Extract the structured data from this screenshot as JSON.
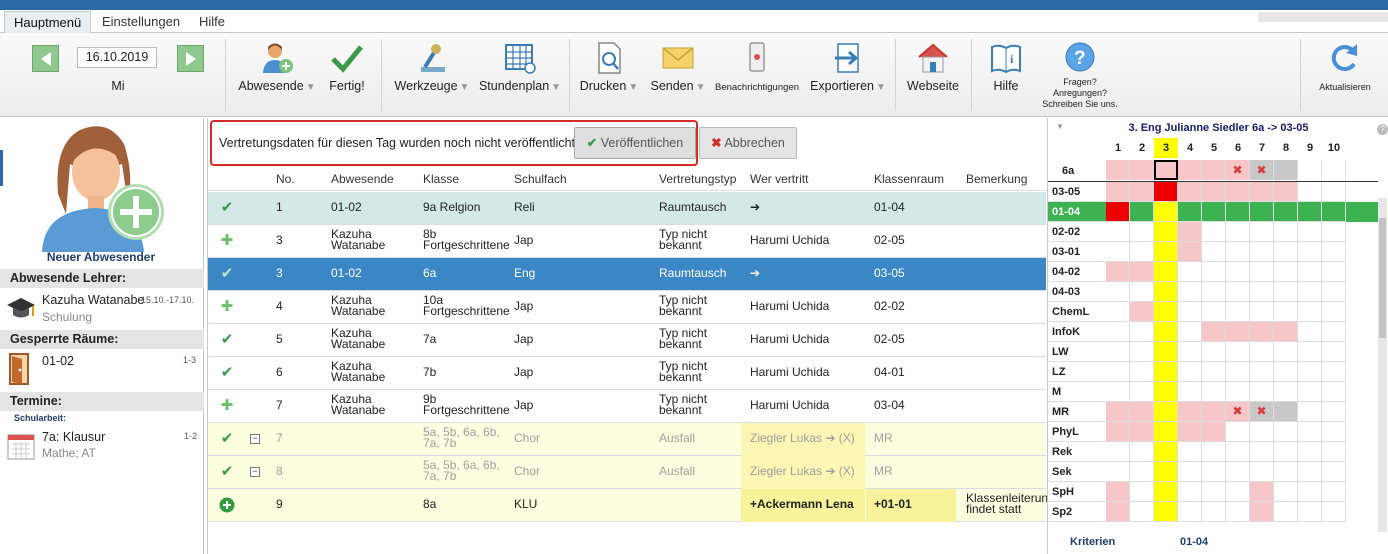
{
  "tabs": [
    "Hauptmenü",
    "Einstellungen",
    "Hilfe"
  ],
  "toolbar": {
    "date": "16.10.2019",
    "weekday": "Mi",
    "buttons": {
      "absent": "Abwesende",
      "done": "Fertig!",
      "tools": "Werkzeuge",
      "timetable": "Stundenplan",
      "print": "Drucken",
      "send": "Senden",
      "notifications": "Benachrichtigungen",
      "export": "Exportieren",
      "website": "Webseite",
      "help": "Hilfe",
      "questions_line1": "Fragen?",
      "questions_line2": "Anregungen?",
      "questions_line3": "Schreiben Sie uns.",
      "refresh": "Aktualisieren"
    }
  },
  "left": {
    "new_absent": "Neuer Abwesender",
    "absent_teachers_header": "Abwesende Lehrer:",
    "teacher_name": "Kazuha Watanabe",
    "teacher_dates": "15.10.-17.10.",
    "teacher_reason": "Schulung",
    "blocked_rooms_header": "Gesperrte Räume:",
    "room_name": "01-02",
    "room_periods": "1-3",
    "events_header": "Termine:",
    "event_category": "Schularbeit:",
    "event_title": "7a: Klausur",
    "event_periods": "1-2",
    "event_sub": "Mathe; AT"
  },
  "notice": {
    "text": "Vertretungsdaten für diesen Tag wurden noch nicht veröffentlicht.",
    "publish": "Veröffentlichen",
    "cancel": "Abbrechen"
  },
  "table": {
    "headers": {
      "no": "No.",
      "absent": "Abwesende",
      "class": "Klasse",
      "subject": "Schulfach",
      "type": "Vertretungstyp",
      "sub": "Wer vertritt",
      "room": "Klassenraum",
      "note": "Bemerkung"
    },
    "rows": [
      {
        "icon": "check",
        "no": "1",
        "absent1": "01-02",
        "absent2": "",
        "class1": "9a Relgion",
        "class2": "",
        "subject": "Reli",
        "type1": "Raumtausch",
        "type2": "",
        "sub": "➔",
        "room": "01-04",
        "note1": "",
        "note2": "",
        "style": "teal"
      },
      {
        "icon": "plus",
        "no": "3",
        "absent1": "Kazuha",
        "absent2": "Watanabe",
        "class1": "8b",
        "class2": "Fortgeschrittene",
        "subject": "Jap",
        "type1": "Typ nicht",
        "type2": "bekannt",
        "sub": "Harumi Uchida",
        "room": "02-05",
        "note1": "",
        "note2": "",
        "style": "white"
      },
      {
        "icon": "check",
        "no": "3",
        "absent1": "01-02",
        "absent2": "",
        "class1": "6a",
        "class2": "",
        "subject": "Eng",
        "type1": "Raumtausch",
        "type2": "",
        "sub": "➔",
        "room": "03-05",
        "note1": "",
        "note2": "",
        "style": "selected"
      },
      {
        "icon": "plus",
        "no": "4",
        "absent1": "Kazuha",
        "absent2": "Watanabe",
        "class1": "10a",
        "class2": "Fortgeschrittene",
        "subject": "Jap",
        "type1": "Typ nicht",
        "type2": "bekannt",
        "sub": "Harumi Uchida",
        "room": "02-02",
        "note1": "",
        "note2": "",
        "style": "white"
      },
      {
        "icon": "check",
        "no": "5",
        "absent1": "Kazuha",
        "absent2": "Watanabe",
        "class1": "7a",
        "class2": "",
        "subject": "Jap",
        "type1": "Typ nicht",
        "type2": "bekannt",
        "sub": "Harumi Uchida",
        "room": "02-05",
        "note1": "",
        "note2": "",
        "style": "white"
      },
      {
        "icon": "check",
        "no": "6",
        "absent1": "Kazuha",
        "absent2": "Watanabe",
        "class1": "7b",
        "class2": "",
        "subject": "Jap",
        "type1": "Typ nicht",
        "type2": "bekannt",
        "sub": "Harumi Uchida",
        "room": "04-01",
        "note1": "",
        "note2": "",
        "style": "white"
      },
      {
        "icon": "plus",
        "no": "7",
        "absent1": "Kazuha",
        "absent2": "Watanabe",
        "class1": "9b",
        "class2": "Fortgeschrittene",
        "subject": "Jap",
        "type1": "Typ nicht",
        "type2": "bekannt",
        "sub": "Harumi Uchida",
        "room": "03-04",
        "note1": "",
        "note2": "",
        "style": "white"
      },
      {
        "icon": "check",
        "minus": true,
        "no": "7",
        "absent1": "",
        "absent2": "",
        "class1": "5a, 5b, 6a, 6b,",
        "class2": "7a, 7b",
        "subject": "Chor",
        "type1": "Ausfall",
        "type2": "",
        "sub": "Ziegler Lukas ➔ (X)",
        "room": "MR",
        "note1": "",
        "note2": "",
        "style": "yellow-dim"
      },
      {
        "icon": "check",
        "minus": true,
        "no": "8",
        "absent1": "",
        "absent2": "",
        "class1": "5a, 5b, 6a, 6b,",
        "class2": "7a, 7b",
        "subject": "Chor",
        "type1": "Ausfall",
        "type2": "",
        "sub": "Ziegler Lukas ➔ (X)",
        "room": "MR",
        "note1": "",
        "note2": "",
        "style": "yellow-dim"
      },
      {
        "icon": "plus-circle",
        "no": "9",
        "absent1": "",
        "absent2": "",
        "class1": "8a",
        "class2": "",
        "subject": "KLU",
        "type1": "",
        "type2": "",
        "sub": "+Ackermann Lena",
        "room": "+01-01",
        "note1": "Klassenleiterun",
        "note2": "findet statt",
        "style": "yellow-bold"
      }
    ]
  },
  "schedule": {
    "title": "3. Eng Julianne Siedler 6a -> 03-05",
    "periods": [
      "1",
      "2",
      "3",
      "4",
      "5",
      "6",
      "7",
      "8",
      "9",
      "10"
    ],
    "class_label": "6a",
    "rooms": [
      "03-05",
      "01-04",
      "02-02",
      "03-01",
      "04-02",
      "04-03",
      "ChemL",
      "InfoK",
      "LW",
      "LZ",
      "M",
      "MR",
      "PhyL",
      "Rek",
      "Sek",
      "SpH",
      "Sp2"
    ],
    "footer_label": "Kriterien",
    "footer_value": "01-04"
  },
  "colors": {
    "accent": "#2b6aa6",
    "selected_row": "#3b86c4",
    "teal_row": "#d4e8e8",
    "yellow_row": "#fdfde0",
    "yellow_cell": "#f8f29a",
    "green_room": "#3cb250",
    "busy_cell": "#f7c6c8",
    "current_col": "#ffff00",
    "conflict": "#ee0000"
  }
}
